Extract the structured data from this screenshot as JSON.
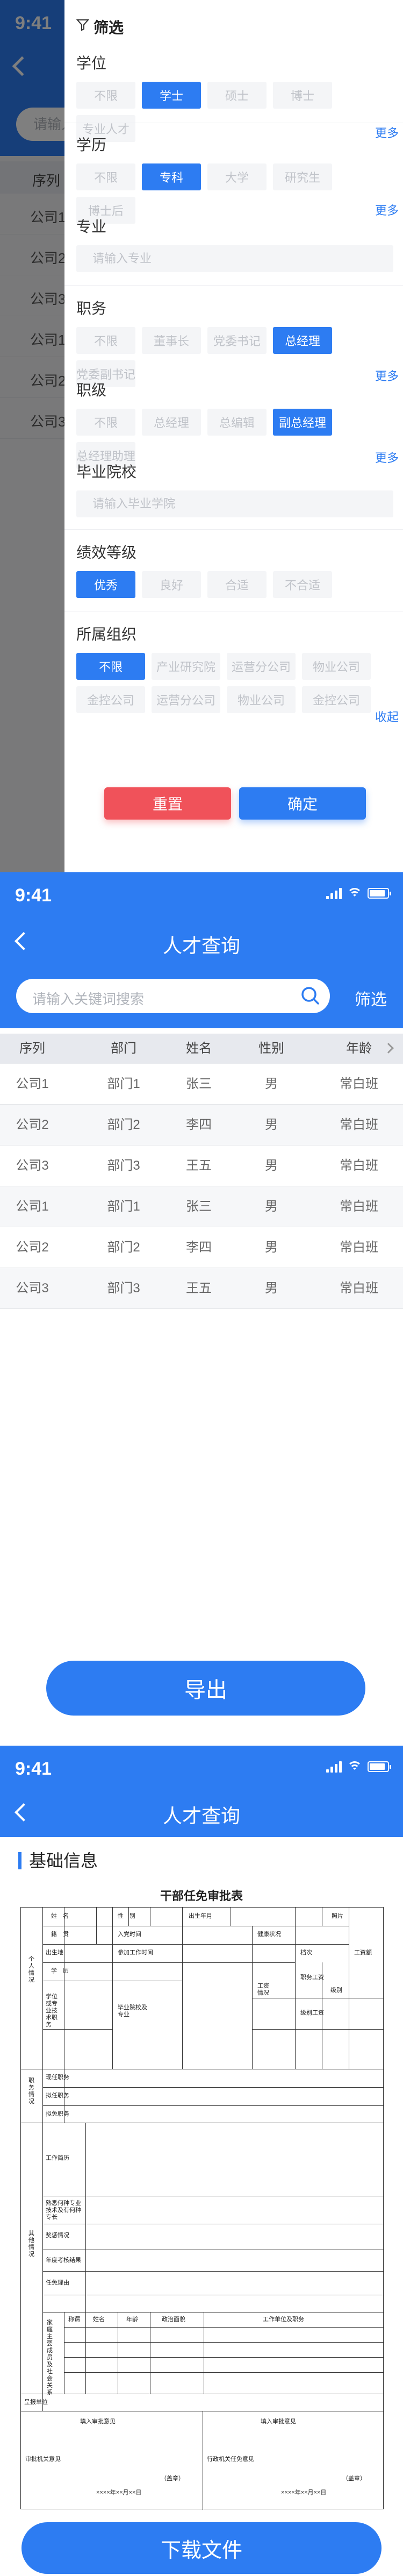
{
  "status": {
    "time": "9:41"
  },
  "screen1": {
    "search_placeholder": "请输入",
    "table_header": "序列",
    "rows": [
      "公司1",
      "公司2",
      "公司3",
      "公司1",
      "公司2",
      "公司3"
    ],
    "filter": {
      "title": "筛选",
      "degree": {
        "label": "学位",
        "options": [
          "不限",
          "学士",
          "硕士",
          "博士",
          "专业人才"
        ],
        "selected": 1,
        "more": "更多"
      },
      "education": {
        "label": "学历",
        "options": [
          "不限",
          "专科",
          "大学",
          "研究生",
          "博士后"
        ],
        "selected": 1,
        "more": "更多"
      },
      "major": {
        "label": "专业",
        "placeholder": "请输入专业"
      },
      "position": {
        "label": "职务",
        "options": [
          "不限",
          "董事长",
          "党委书记",
          "总经理",
          "党委副书记"
        ],
        "selected": 3,
        "more": "更多"
      },
      "rank": {
        "label": "职级",
        "options": [
          "不限",
          "总经理",
          "总编辑",
          "副总经理",
          "总经理助理"
        ],
        "selected": 3,
        "more": "更多"
      },
      "school": {
        "label": "毕业院校",
        "placeholder": "请输入毕业学院"
      },
      "performance": {
        "label": "绩效等级",
        "options": [
          "优秀",
          "良好",
          "合适",
          "不合适"
        ],
        "selected": 0
      },
      "organization": {
        "label": "所属组织",
        "options": [
          "不限",
          "产业研究院",
          "运营分公司",
          "物业公司",
          "金控公司",
          "运营分公司",
          "物业公司",
          "金控公司"
        ],
        "selected": 0,
        "collapse": "收起"
      },
      "reset": "重置",
      "confirm": "确定"
    }
  },
  "screen2": {
    "title": "人才查询",
    "search_placeholder": "请输入关键词搜索",
    "filter": "筛选",
    "columns": [
      "序列",
      "部门",
      "姓名",
      "性别",
      "年龄"
    ],
    "rows": [
      [
        "公司1",
        "部门1",
        "张三",
        "男",
        "常白班"
      ],
      [
        "公司2",
        "部门2",
        "李四",
        "男",
        "常白班"
      ],
      [
        "公司3",
        "部门3",
        "王五",
        "男",
        "常白班"
      ],
      [
        "公司1",
        "部门1",
        "张三",
        "男",
        "常白班"
      ],
      [
        "公司2",
        "部门2",
        "李四",
        "男",
        "常白班"
      ],
      [
        "公司3",
        "部门3",
        "王五",
        "男",
        "常白班"
      ]
    ],
    "export": "导出"
  },
  "screen3": {
    "title": "人才查询",
    "section": "基础信息",
    "form_title": "干部任免审批表",
    "form": {
      "name": "姓　名",
      "gender": "性　别",
      "birth": "出生年月",
      "photo": "照片",
      "ethnic": "籍　贯",
      "party_date": "入党时间",
      "health": "健康状况",
      "birthplace": "出生地",
      "work_date": "参加工作时间",
      "education": "学　历",
      "degree": "学　位",
      "edu_degree": "学位或专业技术职务",
      "graduate": "毕业院校及专业",
      "job": "工资情况",
      "rank_salary": "职务工资",
      "grade_salary": "级别工资",
      "tier": "档次",
      "salary_amount": "工资额",
      "level": "级别",
      "personal": "个人情况",
      "present_job": "现任职务",
      "proposed_job": "拟任职务",
      "removed_job": "拟免职务",
      "job_info": "职务情况",
      "resume": "工作简历",
      "specialty": "熟悉何种专业技术及有何种专长",
      "rewards": "奖惩情况",
      "annual": "年度考核结果",
      "reason": "任免理由",
      "family": "家庭主要成员及社会关系",
      "relation": "称谓",
      "fname": "姓名",
      "age": "年龄",
      "politics": "政治面貌",
      "workplace": "工作单位及职务",
      "other": "其他情况",
      "approval": "呈报单位",
      "opinion1": "审批机关意见",
      "fill1": "填入审批意见",
      "seal1": "（盖章）",
      "date1": "××××年××月××日",
      "opinion2": "行政机关任免意见",
      "fill2": "填入审批意见",
      "seal2": "（盖章）",
      "date2": "××××年××月××日"
    },
    "download": "下载文件"
  }
}
